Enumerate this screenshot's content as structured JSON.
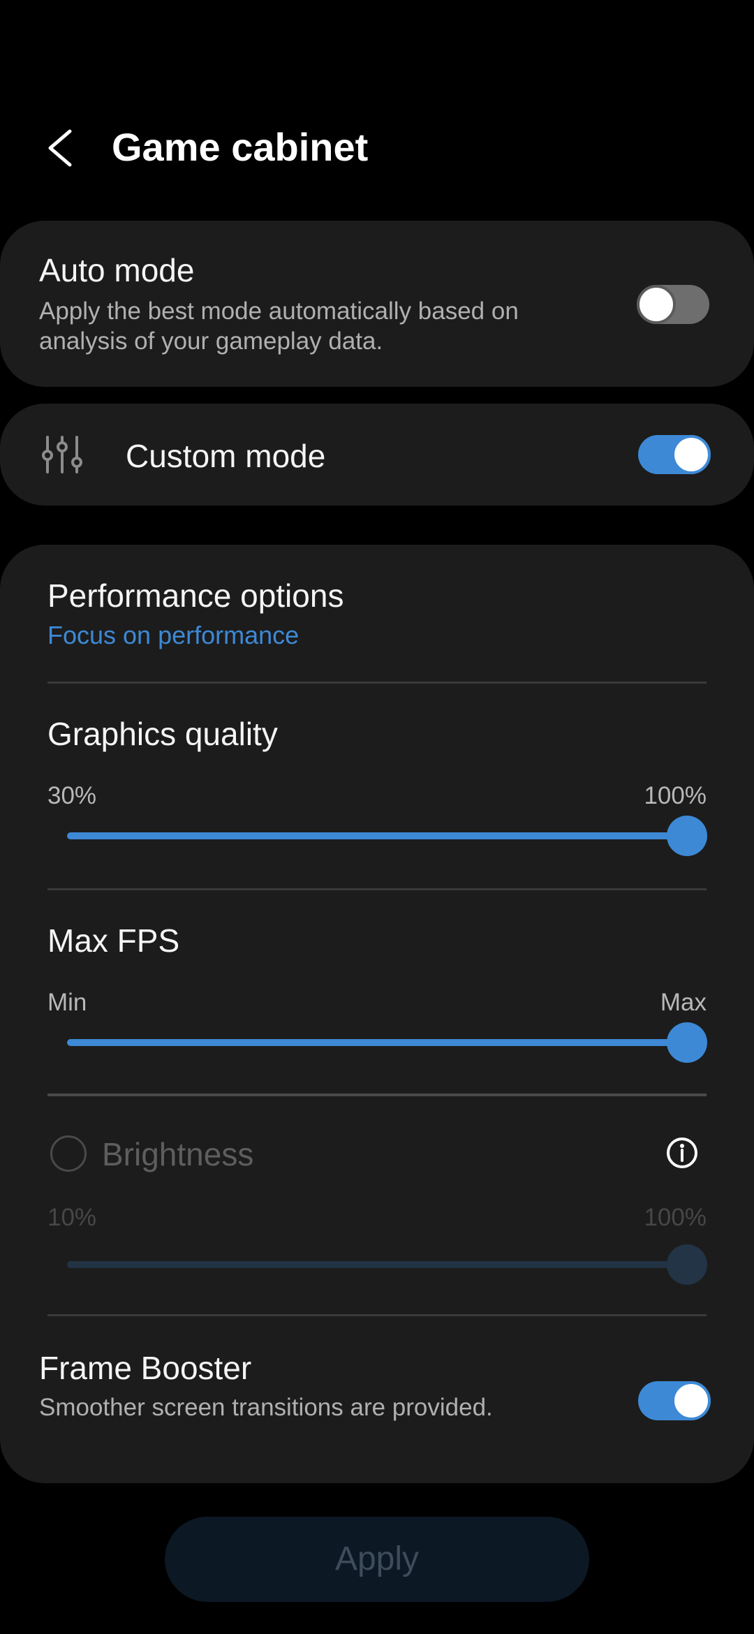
{
  "header": {
    "title": "Game cabinet"
  },
  "auto_mode": {
    "title": "Auto mode",
    "description": "Apply the best mode automatically based on analysis of your gameplay data.",
    "enabled": false
  },
  "custom_mode": {
    "title": "Custom mode",
    "enabled": true
  },
  "performance": {
    "title": "Performance options",
    "value": "Focus on performance"
  },
  "graphics_quality": {
    "title": "Graphics quality",
    "min_label": "30%",
    "max_label": "100%",
    "level": 1.0
  },
  "max_fps": {
    "title": "Max FPS",
    "min_label": "Min",
    "max_label": "Max",
    "level": 1.0
  },
  "brightness": {
    "title": "Brightness",
    "min_label": "10%",
    "max_label": "100%",
    "level": 1.0,
    "checked": false,
    "enabled": false
  },
  "frame_booster": {
    "title": "Frame Booster",
    "description": "Smoother screen transitions are provided.",
    "enabled": true
  },
  "apply_label": "Apply",
  "colors": {
    "accent": "#3d89d6",
    "card_bg": "#1c1c1c",
    "screen_bg": "#000000"
  },
  "icons": {
    "back": "chevron-left-icon",
    "custom": "sliders-icon",
    "info": "info-icon"
  }
}
